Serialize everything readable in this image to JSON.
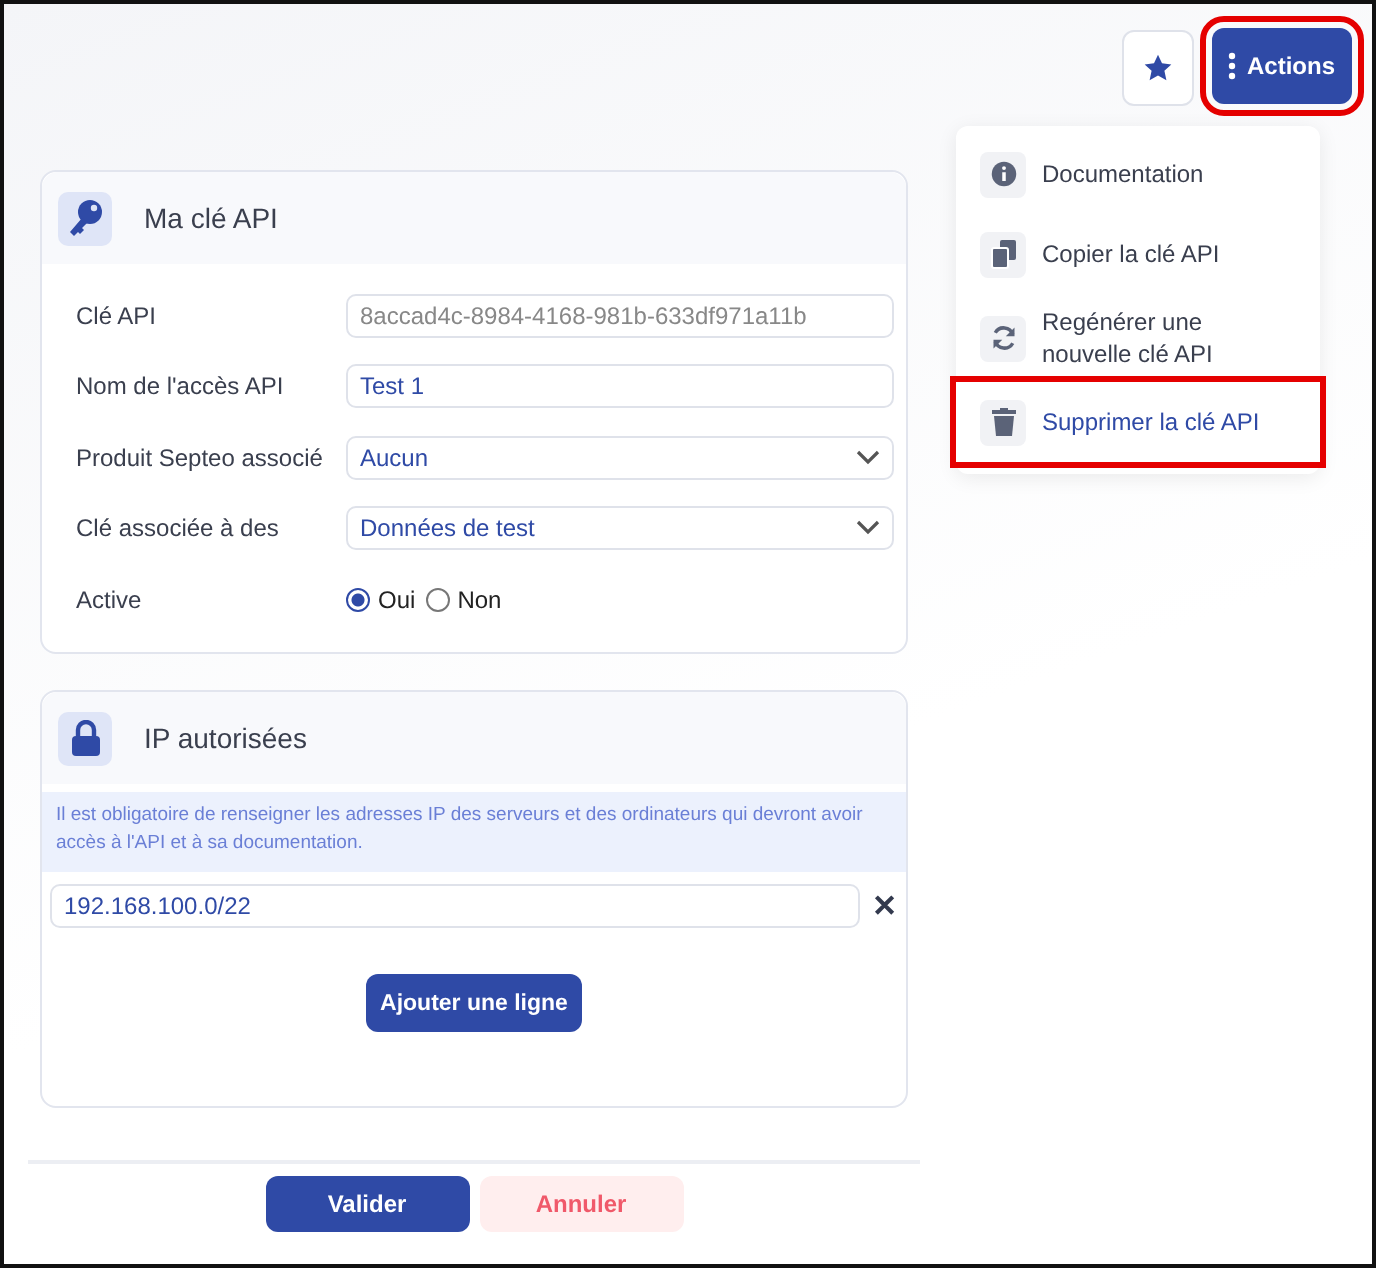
{
  "toolbar": {
    "favorite_highlighted": false,
    "actions": {
      "label": "Actions",
      "highlighted": true
    }
  },
  "menu": {
    "items": [
      {
        "kind": "info",
        "label": "Documentation",
        "highlighted": false
      },
      {
        "kind": "copy",
        "label": "Copier la clé API",
        "highlighted": false
      },
      {
        "kind": "refresh",
        "label": "Regénérer une nouvelle clé API",
        "highlighted": false
      },
      {
        "kind": "trash",
        "label": "Supprimer la clé API",
        "highlighted": true
      }
    ]
  },
  "api_card": {
    "title": "Ma clé API",
    "fields": [
      {
        "kind": "readonly",
        "label": "Clé API",
        "value": "8accad4c-8984-4168-981b-633df971a11b"
      },
      {
        "kind": "text",
        "label": "Nom de l'accès API",
        "value": "Test 1"
      },
      {
        "kind": "select",
        "label": "Produit Septeo associé",
        "value": "Aucun"
      },
      {
        "kind": "select",
        "label": "Clé associée à des",
        "value": "Données de test"
      },
      {
        "kind": "radio",
        "label": "Active",
        "options": [
          {
            "label": "Oui",
            "selected": true
          },
          {
            "label": "Non",
            "selected": false
          }
        ]
      }
    ]
  },
  "ip_card": {
    "title": "IP autorisées",
    "notice": "Il est obligatoire de renseigner les adresses IP des serveurs et des ordinateurs qui devront avoir accès à l'API et à sa documentation.",
    "rows": [
      {
        "value": "192.168.100.0/22",
        "remove": "✕"
      }
    ],
    "add_button": "Ajouter une ligne"
  },
  "footer": {
    "buttons": [
      {
        "kind": "primary",
        "label": "Valider"
      },
      {
        "kind": "cancel",
        "label": "Annuler"
      }
    ]
  }
}
